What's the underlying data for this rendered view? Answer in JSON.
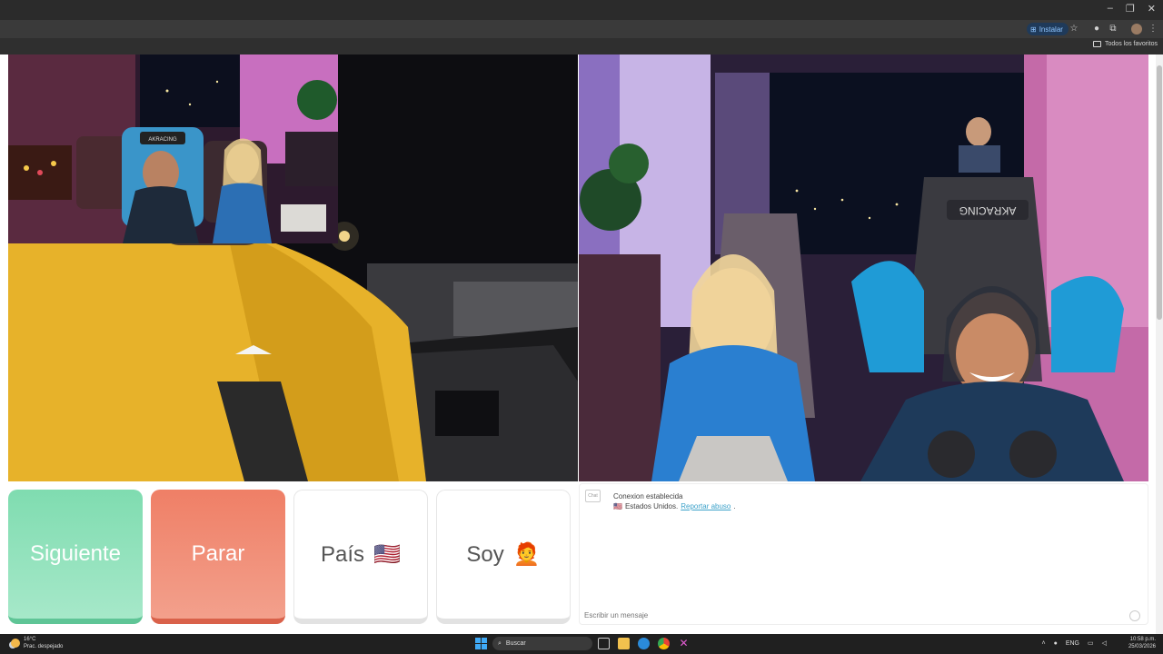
{
  "browser": {
    "install_label": "Instalar",
    "favorites_label": "Todos los favoritos"
  },
  "actions": {
    "next_label": "Siguiente",
    "stop_label": "Parar",
    "country_label": "País",
    "country_flag": "🇺🇸",
    "me_label": "Soy",
    "me_emoji": "🧑‍🦰"
  },
  "chat": {
    "logo_text": "Chat",
    "status": "Conexion establecida",
    "country_flag": "🇺🇸",
    "country": "Estados Unidos.",
    "report_link": "Reportar abuso",
    "input_placeholder": "Escribir un mensaje"
  },
  "taskbar": {
    "temperature": "16°C",
    "weather_desc": "Prac. despejado",
    "search_label": "Buscar",
    "language": "ENG",
    "time": "10:58 p.m.",
    "date": "25/03/2026"
  },
  "overlay": {
    "chair_brand": "AKRACING"
  },
  "partner_video": {
    "chair_brand": "AKRACING"
  }
}
